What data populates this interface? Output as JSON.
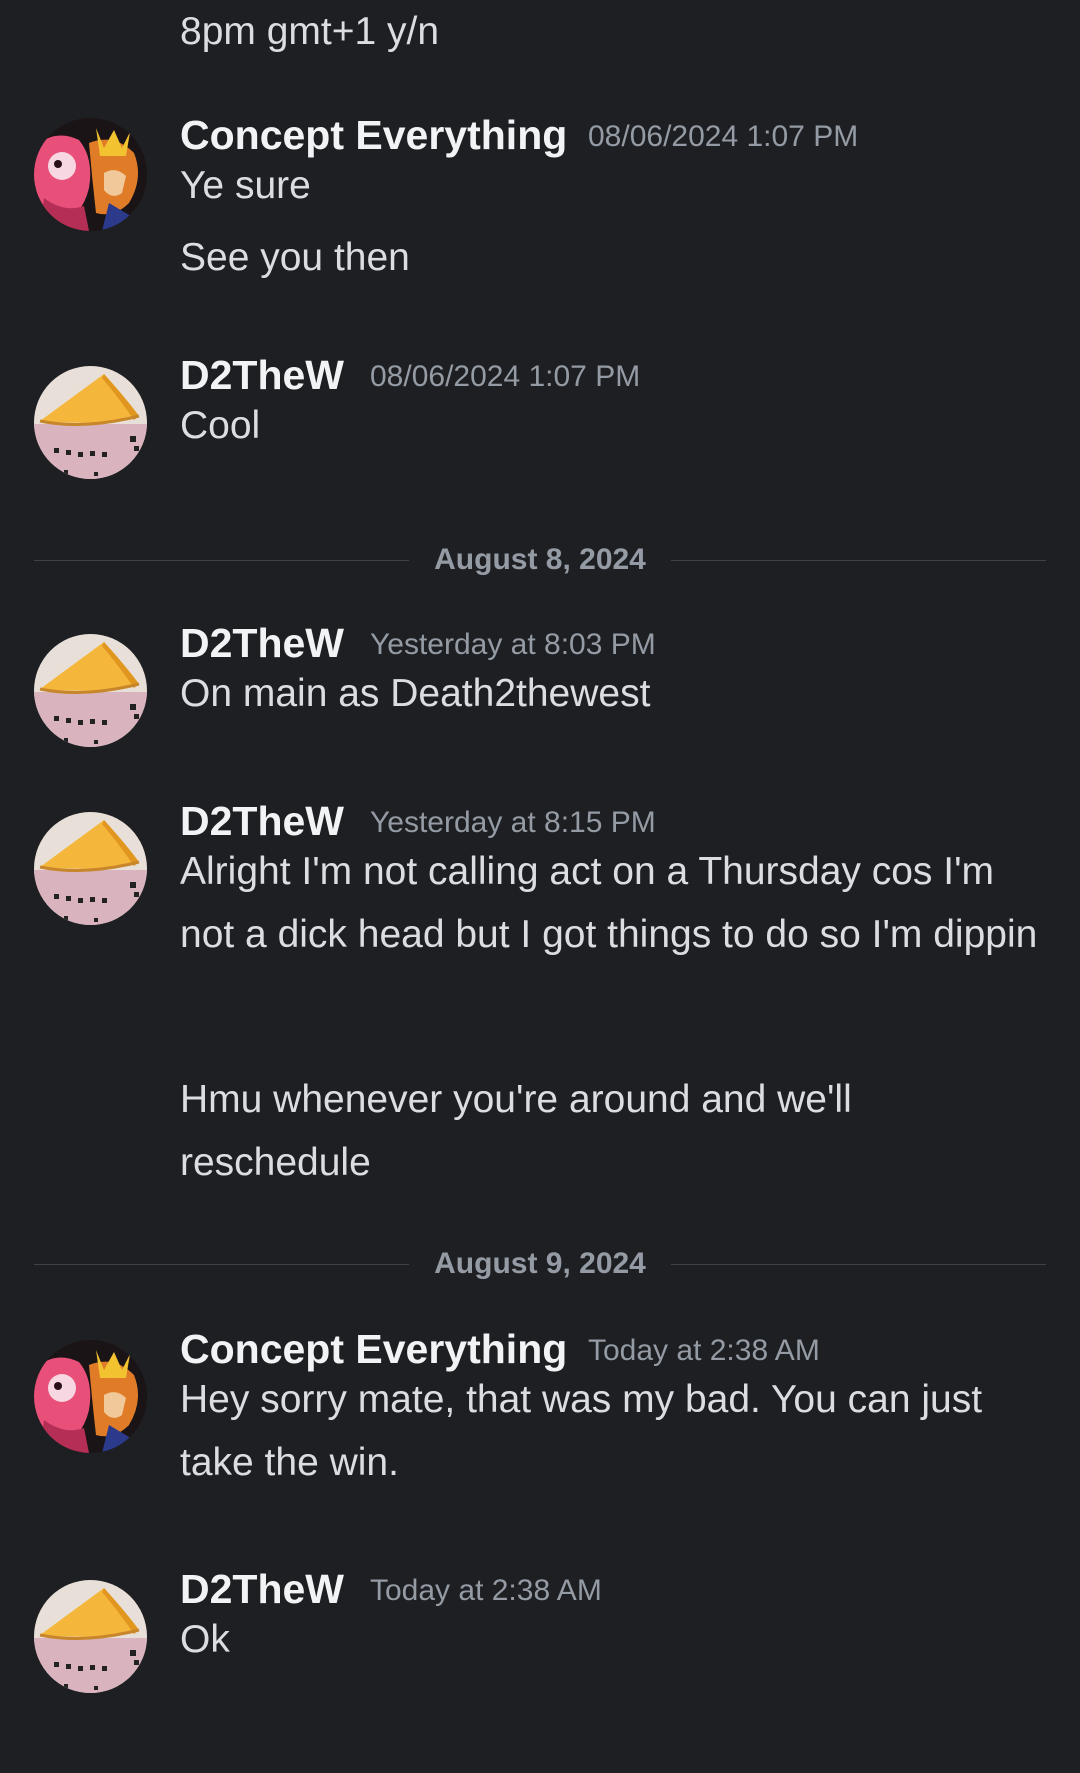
{
  "messages": [
    {
      "continuation": "8pm gmt+1 y/n"
    },
    {
      "author": "Concept Everything",
      "timestamp": "08/06/2024 1:07 PM",
      "lines": [
        "Ye sure",
        "See you then"
      ],
      "avatar_icon": "anime-collage-avatar"
    },
    {
      "author": "D2TheW",
      "timestamp": "08/06/2024 1:07 PM",
      "lines": [
        "Cool"
      ],
      "avatar_icon": "pizza-slice-avatar"
    },
    {
      "divider": "August 8, 2024"
    },
    {
      "author": "D2TheW",
      "timestamp": "Yesterday at 8:03 PM",
      "lines": [
        "On main as Death2thewest"
      ],
      "avatar_icon": "pizza-slice-avatar"
    },
    {
      "author": "D2TheW",
      "timestamp": "Yesterday at 8:15 PM",
      "lines": [
        "Alright I'm not calling act on a Thursday cos I'm not a dick head but I got things to do so I'm dippin",
        "Hmu whenever you're around and we'll reschedule"
      ],
      "avatar_icon": "pizza-slice-avatar"
    },
    {
      "divider": "August 9, 2024"
    },
    {
      "author": "Concept Everything",
      "timestamp": "Today at 2:38 AM",
      "lines": [
        "Hey sorry mate, that was my bad. You can just take the win."
      ],
      "avatar_icon": "anime-collage-avatar"
    },
    {
      "author": "D2TheW",
      "timestamp": "Today at 2:38 AM",
      "lines": [
        "Ok"
      ],
      "avatar_icon": "pizza-slice-avatar"
    }
  ],
  "colors": {
    "background": "#1e1f22",
    "text": "#dbdee1",
    "username": "#f2f3f5",
    "muted": "#949ba4",
    "divider_line": "#3f4147"
  }
}
